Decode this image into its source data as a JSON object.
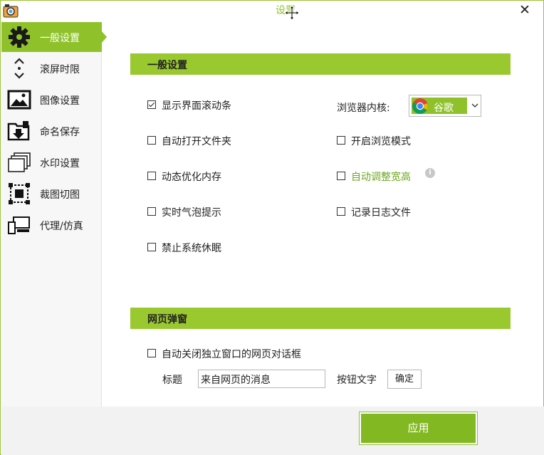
{
  "window": {
    "title": "设置",
    "close_glyph": "✕"
  },
  "sidebar": {
    "items": [
      {
        "label": "一般设置",
        "icon": "gear-icon",
        "active": true
      },
      {
        "label": "滚屏时限",
        "icon": "scroll-updown-icon",
        "active": false
      },
      {
        "label": "图像设置",
        "icon": "image-icon",
        "active": false
      },
      {
        "label": "命名保存",
        "icon": "save-folder-icon",
        "active": false
      },
      {
        "label": "水印设置",
        "icon": "layers-icon",
        "active": false
      },
      {
        "label": "裁图切图",
        "icon": "crop-icon",
        "active": false
      },
      {
        "label": "代理/仿真",
        "icon": "devices-icon",
        "active": false
      }
    ]
  },
  "general": {
    "header": "一般设置",
    "options_left": [
      {
        "label": "显示界面滚动条",
        "checked": true
      },
      {
        "label": "自动打开文件夹",
        "checked": false
      },
      {
        "label": "动态优化内存",
        "checked": false
      },
      {
        "label": "实时气泡提示",
        "checked": false
      },
      {
        "label": "禁止系统休眠",
        "checked": false
      }
    ],
    "browser_kernel_label": "浏览器内核:",
    "browser_kernel_value": "谷歌",
    "options_right": [
      {
        "label": "开启浏览模式",
        "checked": false
      },
      {
        "label": "自动调整宽高",
        "checked": false
      },
      {
        "label": "记录日志文件",
        "checked": false
      }
    ]
  },
  "popup": {
    "header": "网页弹窗",
    "auto_close_label": "自动关闭独立窗口的网页对话框",
    "auto_close_checked": false,
    "title_label": "标题",
    "title_value": "来自网页的消息",
    "button_text_label": "按钮文字",
    "button_text_value": "确定"
  },
  "footer": {
    "apply_label": "应用"
  },
  "colors": {
    "accent": "#8fc22a",
    "accent_dark": "#82b922",
    "highlight_text": "#6aa61c"
  }
}
